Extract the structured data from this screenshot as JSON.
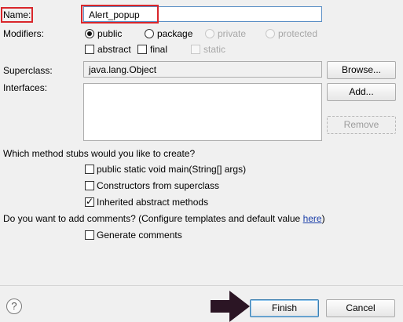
{
  "form": {
    "name_label": "Name:",
    "name_value": "Alert_popup",
    "modifiers_label": "Modifiers:",
    "modifiers": {
      "public": "public",
      "package": "package",
      "private": "private",
      "protected": "protected",
      "abstract": "abstract",
      "final": "final",
      "static": "static"
    },
    "superclass_label": "Superclass:",
    "superclass_value": "java.lang.Object",
    "browse_label": "Browse...",
    "interfaces_label": "Interfaces:",
    "add_label": "Add...",
    "remove_label": "Remove",
    "stubs_question": "Which method stubs would you like to create?",
    "stubs": {
      "main": "public static void main(String[] args)",
      "constructors": "Constructors from superclass",
      "inherited": "Inherited abstract methods"
    },
    "comments_question": "Do you want to add comments? (Configure templates and default value ",
    "comments_link": "here",
    "comments_tail": ")",
    "generate_comments": "Generate comments"
  },
  "footer": {
    "help_glyph": "?",
    "finish_label": "Finish",
    "cancel_label": "Cancel"
  },
  "colors": {
    "highlight_red": "#d9262b",
    "arrow": "#2b1524",
    "link": "#1a3ea8"
  },
  "icons": [
    "help-icon",
    "arrow-pointer-icon"
  ]
}
